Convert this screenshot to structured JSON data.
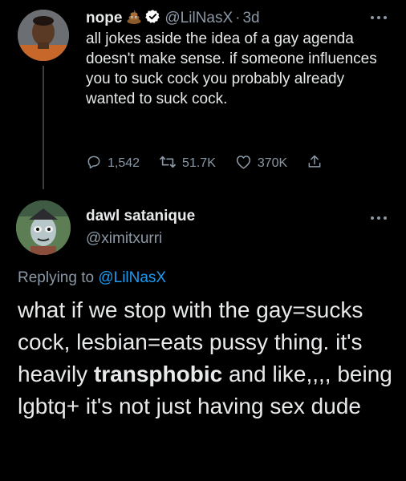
{
  "tweet": {
    "author_name": "nope",
    "author_emoji": "poop-emoji",
    "verified_icon": "verified-badge-icon",
    "author_handle": "@LilNasX",
    "separator": "·",
    "time": "3d",
    "text": "all jokes aside the idea of a gay agenda doesn't make sense. if someone influences you to suck cock you probably already wanted to suck cock.",
    "replies": "1,542",
    "retweets": "51.7K",
    "likes": "370K",
    "accent_color": "#1d9bf0"
  },
  "reply": {
    "author_name": "dawl satanique",
    "author_handle": "@ximitxurri",
    "replying_prefix": "Replying to",
    "replying_to": "@LilNasX",
    "text_part1": "what if we stop with the gay=sucks cock, lesbian=eats pussy thing. it's heavily ",
    "text_bold": "transphobic",
    "text_part2": " and like,,,, being lgbtq+ it's not just having sex dude"
  }
}
